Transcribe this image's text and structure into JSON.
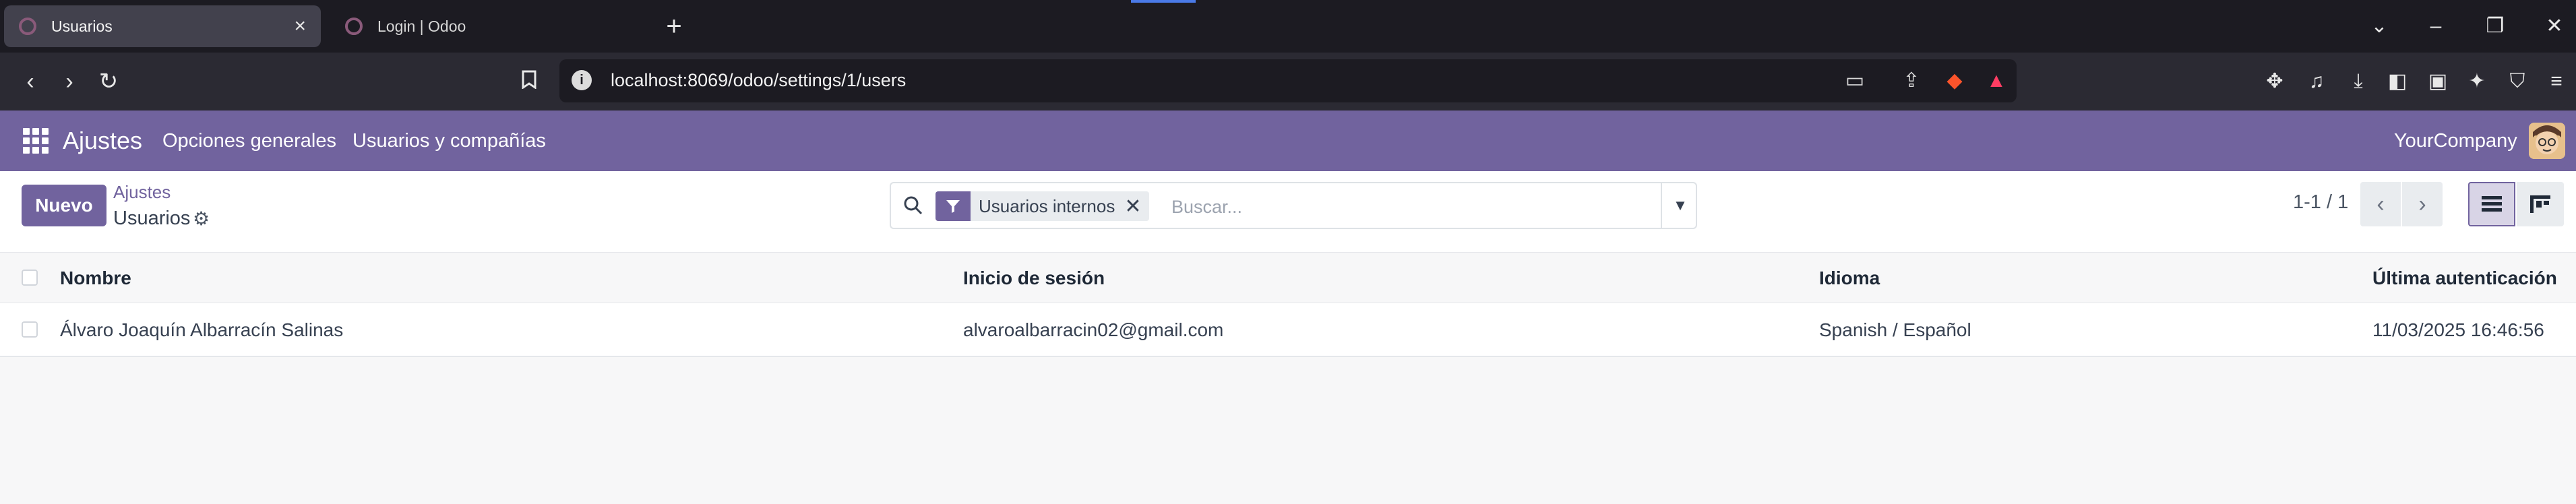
{
  "browser": {
    "tabs": [
      {
        "title": "Usuarios",
        "active": true
      },
      {
        "title": "Login | Odoo",
        "active": false
      }
    ],
    "url": "localhost:8069/odoo/settings/1/users"
  },
  "odoo": {
    "app_name": "Ajustes",
    "menu": [
      "Opciones generales",
      "Usuarios y compañías"
    ],
    "company": "YourCompany",
    "brand_color": "#71639e"
  },
  "control": {
    "new_button": "Nuevo",
    "breadcrumb_parent": "Ajustes",
    "breadcrumb_current": "Usuarios",
    "search": {
      "facet_label": "Usuarios internos",
      "placeholder": "Buscar..."
    },
    "pager": "1-1 / 1"
  },
  "list": {
    "columns": [
      "Nombre",
      "Inicio de sesión",
      "Idioma",
      "Última autenticación"
    ],
    "rows": [
      [
        "Álvaro Joaquín Albarracín Salinas",
        "alvaroalbarracin02@gmail.com",
        "Spanish / Español",
        "11/03/2025 16:46:56"
      ]
    ]
  }
}
